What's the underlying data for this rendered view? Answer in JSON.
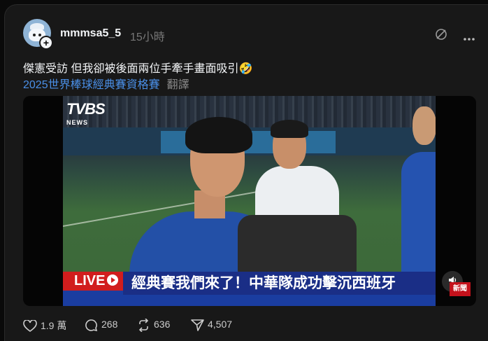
{
  "post": {
    "username": "mmmsa5_5",
    "time_ago": "15小時",
    "caption": "傑憲受訪 但我卻被後面兩位手牽手畫面吸引🤣",
    "tag": "2025世界棒球經典賽資格賽",
    "translate_label": "翻譯"
  },
  "video": {
    "channel_logo": "TVBS",
    "channel_sub": "NEWS",
    "live_label": "LIVE",
    "headline": "經典賽我們來了！中華隊成功擊沉西班牙",
    "corner_tag": "新聞"
  },
  "actions": {
    "likes": "1.9 萬",
    "comments": "268",
    "reposts": "636",
    "shares": "4,507"
  },
  "icons": {
    "avatar": "avatar-icon",
    "follow": "plus-icon",
    "hide": "eye-off-icon",
    "more": "more-icon",
    "mute": "speaker-icon",
    "like": "heart-icon",
    "comment": "comment-icon",
    "repost": "repost-icon",
    "share": "send-icon"
  }
}
